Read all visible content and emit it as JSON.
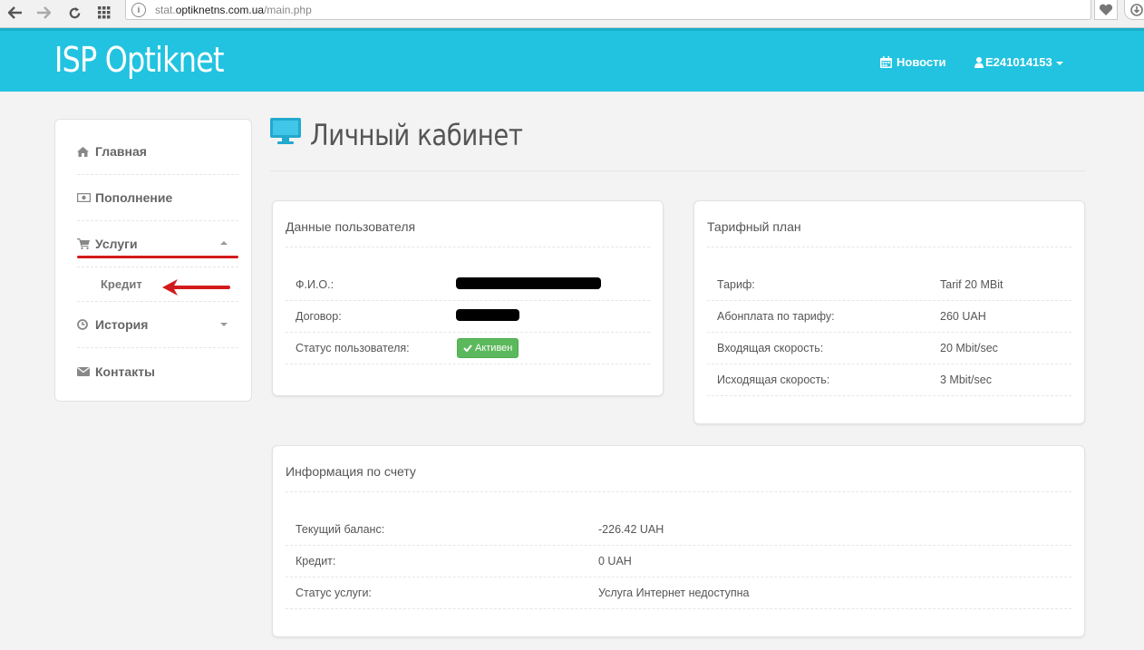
{
  "browser": {
    "url_sub": "stat.",
    "url_domain": "optiknetns.com.ua",
    "url_path": "/main.php"
  },
  "navbar": {
    "brand": "ISP Optiknet",
    "news_label": "Новости",
    "user_label": "E241014153",
    "color": "#22c3e0"
  },
  "sidebar": {
    "items": [
      {
        "label": "Главная",
        "icon": "home-icon"
      },
      {
        "label": "Пополнение",
        "icon": "money-icon"
      },
      {
        "label": "Услуги",
        "icon": "cart-icon",
        "expanded": true,
        "children": [
          {
            "label": "Кредит"
          }
        ]
      },
      {
        "label": "История",
        "icon": "clock-icon",
        "expanded": false
      },
      {
        "label": "Контакты",
        "icon": "envelope-icon"
      }
    ]
  },
  "page": {
    "title": "Личный кабинет",
    "title_icon": "monitor-icon"
  },
  "user_panel": {
    "heading": "Данные пользователя",
    "rows": [
      {
        "label": "Ф.И.О.:",
        "value": ""
      },
      {
        "label": "Договор:",
        "value": ""
      },
      {
        "label": "Статус пользователя:",
        "value": "Активен"
      }
    ],
    "status_color": "#5cb85c"
  },
  "tariff_panel": {
    "heading": "Тарифный план",
    "rows": [
      {
        "label": "Тариф:",
        "value": "Tarif 20 MBit"
      },
      {
        "label": "Абонплата по тарифу:",
        "value": "260 UAH"
      },
      {
        "label": "Входящая скорость:",
        "value": "20 Mbit/sec"
      },
      {
        "label": "Исходящая скорость:",
        "value": "3 Mbit/sec"
      }
    ]
  },
  "account_panel": {
    "heading": "Информация по счету",
    "rows": [
      {
        "label": "Текущий баланс:",
        "value": "-226.42 UAH"
      },
      {
        "label": "Кредит:",
        "value": "0 UAH"
      },
      {
        "label": "Статус услуги:",
        "value": "Услуга Интернет недоступна"
      }
    ]
  },
  "annotation_color": "#d21a1a"
}
